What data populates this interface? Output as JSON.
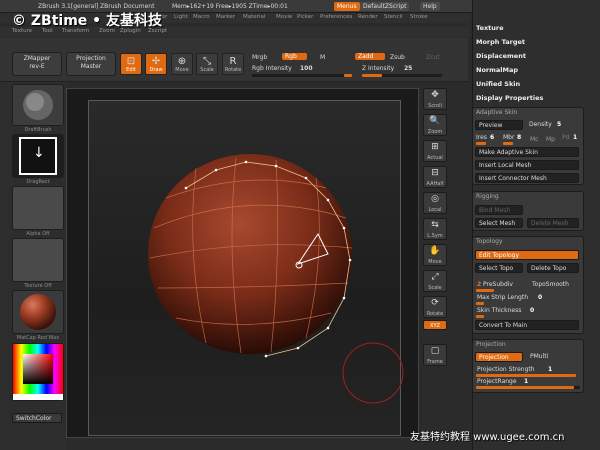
{
  "logo": {
    "text": "© ZBtime • 友基科技"
  },
  "titlebar": {
    "app_title": "ZBrush  3.1[general]",
    "document": "ZBrush Document",
    "mem": "Mem▸162+19 Free▸1905 ZTime▸00:01",
    "menus_label": "Menus",
    "zscript_label": "DefaultZScript",
    "help_label": "Help"
  },
  "menubar": {
    "items": [
      "Layer",
      "Light",
      "Macro",
      "Marker",
      "Material",
      "Movie",
      "Picker",
      "Preferences",
      "Render",
      "Stencil",
      "Stroke"
    ]
  },
  "menubar2": {
    "items": [
      "Texture",
      "Tool",
      "Transform",
      "Zoom",
      "Zplugin",
      "Zscript"
    ]
  },
  "toolbar": {
    "zmapper": "ZMapper",
    "zmapper_sub": "rev-E",
    "projection": "Projection",
    "projection_sub": "Master",
    "edit": "Edit",
    "draw": "Draw",
    "move": "Move",
    "scale": "Scale",
    "rotate": "Rotate",
    "mrgb": "Mrgb",
    "rgb": "Rgb",
    "m": "M",
    "zadd": "Zadd",
    "zsub": "Zsub",
    "zcut": "Zcut",
    "rgb_intensity_label": "Rgb Intensity",
    "rgb_intensity": "100",
    "z_intensity_label": "Z Intensity",
    "z_intensity": "25"
  },
  "leftshelf": {
    "lightbox_label": "DraftBrush",
    "stroke_label": "DragRect",
    "alpha_label": "Alpha Off",
    "texture_label": "Texture Off",
    "material_label": "MatCap Red Wax",
    "switchcolor": "SwitchColor"
  },
  "right_icons": [
    {
      "name": "scroll",
      "label": "Scroll",
      "icon": "✥"
    },
    {
      "name": "zoom",
      "label": "Zoom",
      "icon": "🔍"
    },
    {
      "name": "actual",
      "label": "Actual",
      "icon": "⊞"
    },
    {
      "name": "aahalf",
      "label": "AAHalf",
      "icon": "⊟"
    },
    {
      "name": "local",
      "label": "Local",
      "icon": "◎"
    },
    {
      "name": "lsym",
      "label": "L.Sym",
      "icon": "⇆"
    },
    {
      "name": "move",
      "label": "Move",
      "icon": "✋"
    },
    {
      "name": "scale",
      "label": "Scale",
      "icon": "⤢"
    },
    {
      "name": "rotate",
      "label": "Rotate",
      "icon": "⟳"
    },
    {
      "name": "xyz",
      "label": "XYZ",
      "icon": ""
    },
    {
      "name": "frame",
      "label": "Frame",
      "icon": "▢"
    }
  ],
  "rpanel": {
    "top_items": [
      "Texture",
      "Morph Target",
      "Displacement",
      "NormalMap",
      "Unified Skin",
      "Display Properties"
    ],
    "adaptive": {
      "title": "Adaptive Skin",
      "preview": "Preview",
      "density_label": "Density",
      "density": "5",
      "ires_label": "Ires",
      "ires": "6",
      "mbr_label": "Mbr",
      "mbr": "8",
      "mc": "Mc",
      "mp": "Mp",
      "pd_label": "Pd",
      "pd": "1",
      "make": "Make Adaptive Skin",
      "insert_local": "Insert Local Mesh",
      "insert_connector": "Insert Connector Mesh"
    },
    "rigging": {
      "title": "Rigging",
      "bind": "Bind Mesh",
      "select": "Select Mesh",
      "delete": "Delete Mesh"
    },
    "topology": {
      "title": "Topology",
      "edit": "Edit Topology",
      "select": "Select Topo",
      "delete": "Delete Topo",
      "presubdiv_num": "2",
      "presubdiv": "PreSubdiv",
      "toposmooth": "TopoSmooth",
      "max_strip_label": "Max Strip Length",
      "max_strip": "0",
      "skin_thick_label": "Skin Thickness",
      "skin_thick": "0",
      "convert": "Convert To Main"
    },
    "projection": {
      "title": "Projection",
      "projection": "Projection",
      "pmulti": "PMulti",
      "strength_label": "Projection Strength",
      "strength": "1",
      "range_label": "ProjectRange",
      "range": "1"
    }
  },
  "watermark": "友基特约教程 www.ugee.com.cn",
  "colors": {
    "accent": "#e06a12",
    "sphere": "#8a3520"
  }
}
